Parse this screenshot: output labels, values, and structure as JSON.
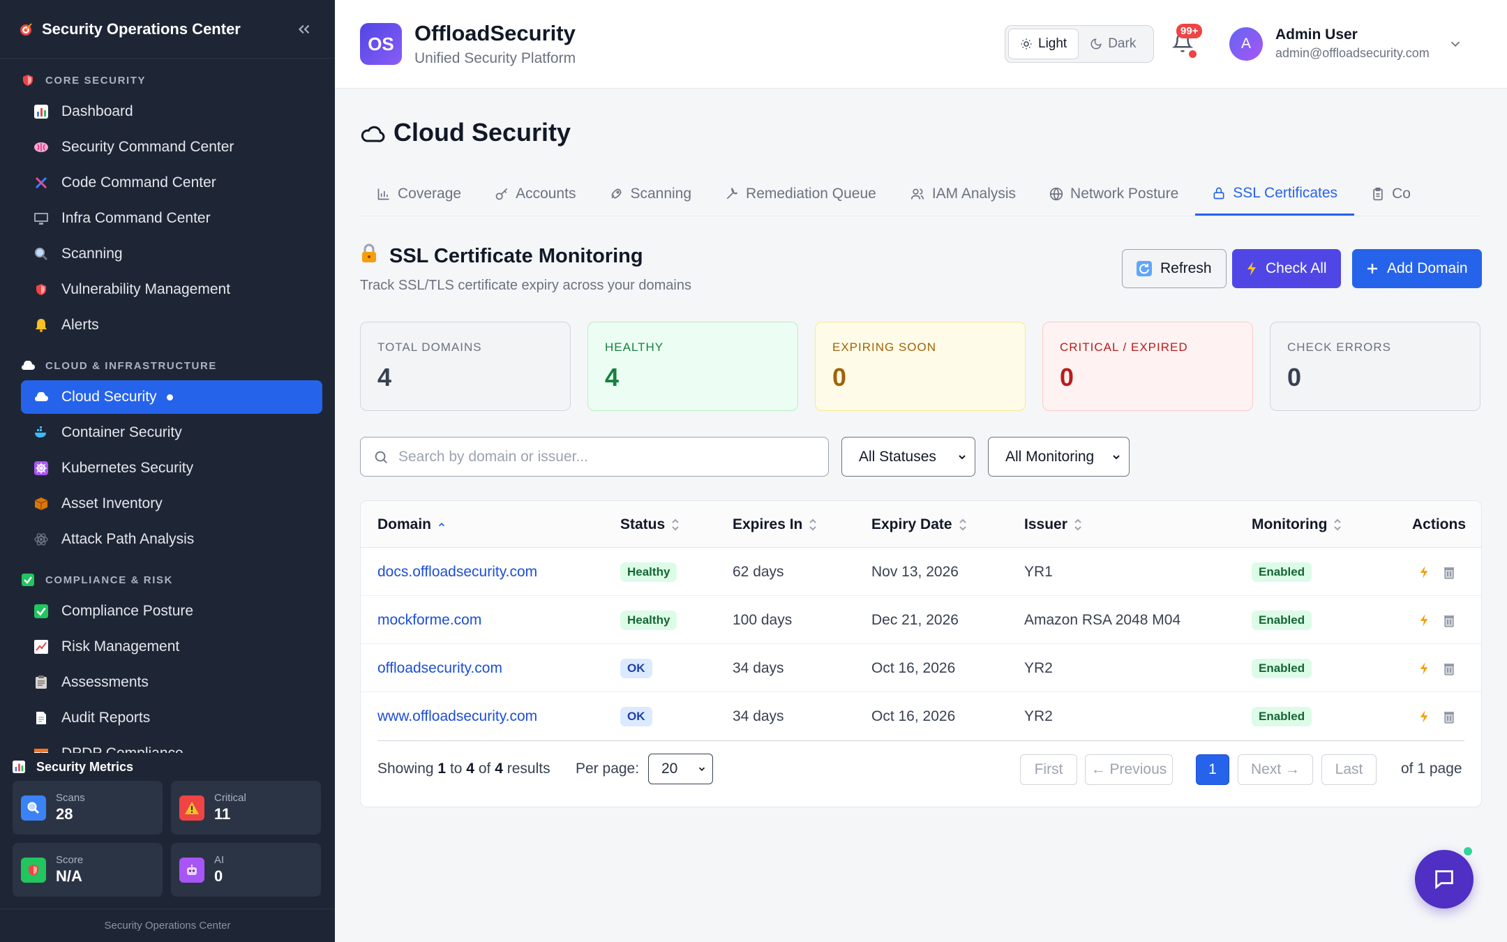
{
  "sidebar": {
    "title": "Security Operations Center",
    "sections": [
      {
        "label": "CORE SECURITY",
        "icon": "shield-icon",
        "items": [
          {
            "label": "Dashboard",
            "icon": "bar-chart-icon"
          },
          {
            "label": "Security Command Center",
            "icon": "brain-icon"
          },
          {
            "label": "Code Command Center",
            "icon": "dna-icon"
          },
          {
            "label": "Infra Command Center",
            "icon": "monitor-icon"
          },
          {
            "label": "Scanning",
            "icon": "magnifier-icon"
          },
          {
            "label": "Vulnerability Management",
            "icon": "shield-icon"
          },
          {
            "label": "Alerts",
            "icon": "bell-icon"
          }
        ]
      },
      {
        "label": "CLOUD & INFRASTRUCTURE",
        "icon": "cloud-icon",
        "items": [
          {
            "label": "Cloud Security",
            "icon": "cloud-icon",
            "active": true
          },
          {
            "label": "Container Security",
            "icon": "whale-icon"
          },
          {
            "label": "Kubernetes Security",
            "icon": "helm-icon"
          },
          {
            "label": "Asset Inventory",
            "icon": "package-icon"
          },
          {
            "label": "Attack Path Analysis",
            "icon": "atom-icon"
          }
        ]
      },
      {
        "label": "COMPLIANCE & RISK",
        "icon": "check-icon",
        "items": [
          {
            "label": "Compliance Posture",
            "icon": "check-icon"
          },
          {
            "label": "Risk Management",
            "icon": "trend-icon"
          },
          {
            "label": "Assessments",
            "icon": "clipboard-icon"
          },
          {
            "label": "Audit Reports",
            "icon": "document-icon"
          },
          {
            "label": "DPDP Compliance",
            "icon": "flag-icon"
          }
        ]
      }
    ],
    "metrics": {
      "title": "Security Metrics",
      "cards": [
        {
          "label": "Scans",
          "value": "28",
          "icon": "magnifier-icon",
          "color": "#3b82f6"
        },
        {
          "label": "Critical",
          "value": "11",
          "icon": "warning-icon",
          "color": "#ef4444"
        },
        {
          "label": "Score",
          "value": "N/A",
          "icon": "shield-icon",
          "color": "#22c55e"
        },
        {
          "label": "AI",
          "value": "0",
          "icon": "robot-icon",
          "color": "#a855f7"
        }
      ]
    },
    "footer": "Security Operations Center"
  },
  "header": {
    "badge": "OS",
    "brand": "OffloadSecurity",
    "subtitle": "Unified Security Platform",
    "theme": {
      "light": "Light",
      "dark": "Dark",
      "selected": "Light"
    },
    "notifications": "99+",
    "user": {
      "initial": "A",
      "name": "Admin User",
      "email": "admin@offloadsecurity.com"
    }
  },
  "page": {
    "title": "Cloud Security",
    "tabs": [
      {
        "label": "Coverage",
        "icon": "bar-chart-icon"
      },
      {
        "label": "Accounts",
        "icon": "key-icon"
      },
      {
        "label": "Scanning",
        "icon": "rocket-icon"
      },
      {
        "label": "Remediation Queue",
        "icon": "wrench-icon"
      },
      {
        "label": "IAM Analysis",
        "icon": "users-icon"
      },
      {
        "label": "Network Posture",
        "icon": "globe-icon"
      },
      {
        "label": "SSL Certificates",
        "icon": "lock-icon",
        "active": true
      },
      {
        "label": "Co",
        "icon": "clipboard-icon"
      }
    ]
  },
  "ssl": {
    "title": "SSL Certificate Monitoring",
    "subtitle": "Track SSL/TLS certificate expiry across your domains",
    "buttons": {
      "refresh": "Refresh",
      "check_all": "Check All",
      "add_domain": "Add Domain"
    },
    "stats": [
      {
        "label": "TOTAL DOMAINS",
        "value": "4",
        "tone": "gray"
      },
      {
        "label": "HEALTHY",
        "value": "4",
        "tone": "green"
      },
      {
        "label": "EXPIRING SOON",
        "value": "0",
        "tone": "yellow"
      },
      {
        "label": "CRITICAL / EXPIRED",
        "value": "0",
        "tone": "red"
      },
      {
        "label": "CHECK ERRORS",
        "value": "0",
        "tone": "gray"
      }
    ],
    "search_placeholder": "Search by domain or issuer...",
    "status_filter": "All Statuses",
    "monitoring_filter": "All Monitoring",
    "columns": [
      "Domain",
      "Status",
      "Expires In",
      "Expiry Date",
      "Issuer",
      "Monitoring",
      "Actions"
    ],
    "rows": [
      {
        "domain": "docs.offloadsecurity.com",
        "status": "Healthy",
        "expires_in": "62 days",
        "expiry_date": "Nov 13, 2026",
        "issuer": "YR1",
        "monitoring": "Enabled"
      },
      {
        "domain": "mockforme.com",
        "status": "Healthy",
        "expires_in": "100 days",
        "expiry_date": "Dec 21, 2026",
        "issuer": "Amazon RSA 2048 M04",
        "monitoring": "Enabled"
      },
      {
        "domain": "offloadsecurity.com",
        "status": "OK",
        "expires_in": "34 days",
        "expiry_date": "Oct 16, 2026",
        "issuer": "YR2",
        "monitoring": "Enabled"
      },
      {
        "domain": "www.offloadsecurity.com",
        "status": "OK",
        "expires_in": "34 days",
        "expiry_date": "Oct 16, 2026",
        "issuer": "YR2",
        "monitoring": "Enabled"
      }
    ],
    "pagination": {
      "showing_prefix": "Showing",
      "from": "1",
      "to_word": "to",
      "to": "4",
      "of_word": "of",
      "total": "4",
      "suffix": "results",
      "per_page_label": "Per page:",
      "per_page": "20",
      "first": "First",
      "previous": "← Previous",
      "current": "1",
      "next": "Next →",
      "last": "Last",
      "of_pages": "of 1 page"
    }
  }
}
